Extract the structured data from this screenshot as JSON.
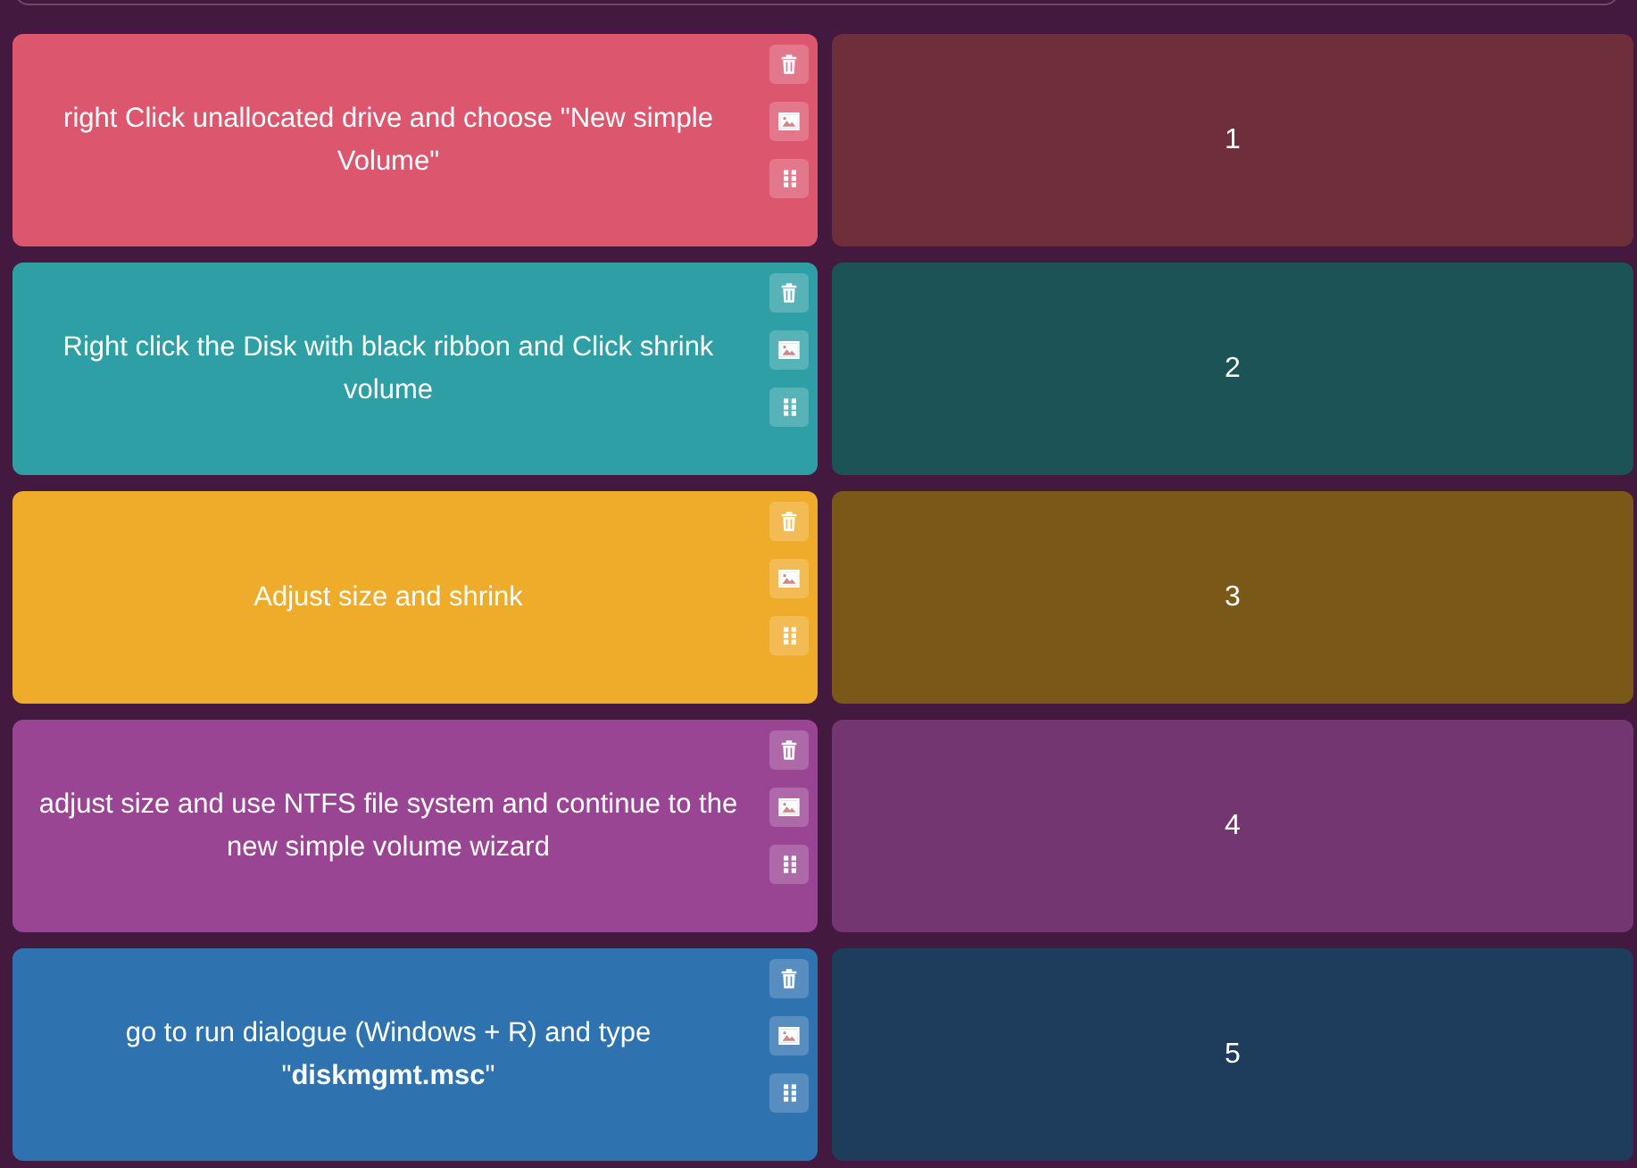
{
  "cards": [
    {
      "text": "right Click unallocated drive and choose \"New simple Volume\"",
      "color": "#dc566e",
      "answer": {
        "text": "1",
        "color": "#6e2f3b"
      }
    },
    {
      "text": "Right click the Disk with black ribbon and Click shrink volume",
      "color": "#2ea0a5",
      "answer": {
        "text": "2",
        "color": "#1b5357"
      }
    },
    {
      "text": "Adjust size and shrink",
      "color": "#efab2a",
      "answer": {
        "text": "3",
        "color": "#7a5818"
      }
    },
    {
      "text": "adjust size and use NTFS file system and continue to the new simple volume wizard",
      "color": "#9a4494",
      "answer": {
        "text": "4",
        "color": "#743670"
      }
    },
    {
      "text": "go to run dialogue (Windows + R) and type \"**diskmgmt.msc**\"",
      "color": "#2e72b0",
      "answer": {
        "text": "5",
        "color": "#1e3d5c"
      }
    }
  ]
}
